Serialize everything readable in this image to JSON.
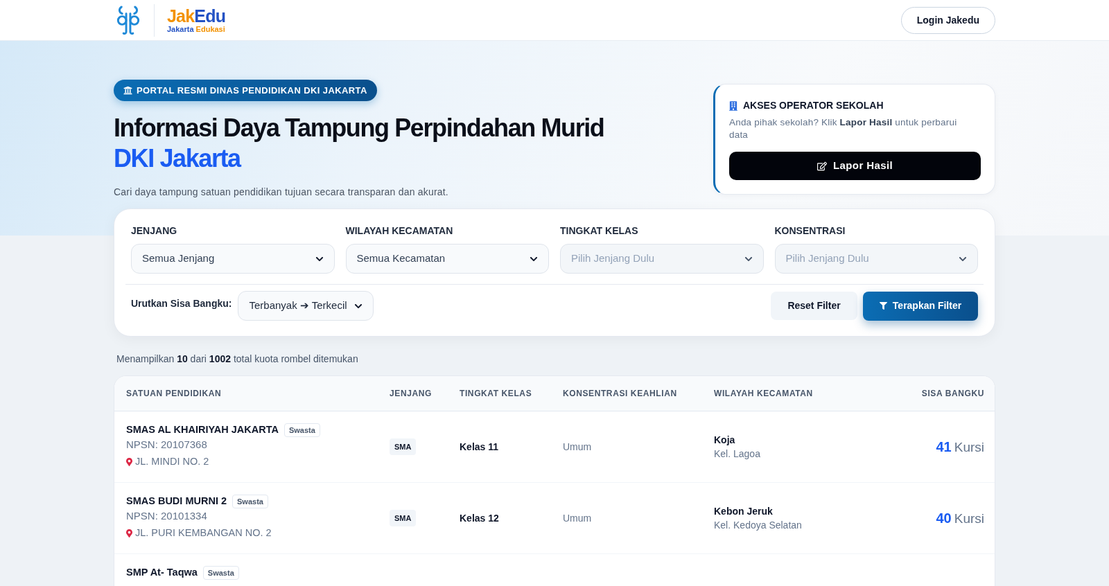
{
  "header": {
    "logo": {
      "wordmark": [
        "Jak",
        "Edu"
      ],
      "tagline": [
        "Jakarta",
        "Edukasi"
      ]
    },
    "login_button": "Login Jakedu"
  },
  "hero": {
    "badge": "PORTAL RESMI DINAS PENDIDIKAN DKI JAKARTA",
    "title": "Informasi Daya Tampung Perpindahan Murid",
    "title_highlight": "DKI Jakarta",
    "subtitle": "Cari daya tampung satuan pendidikan tujuan secara transparan dan akurat."
  },
  "operator_card": {
    "title": "AKSES OPERATOR SEKOLAH",
    "text": "Anda pihak sekolah? Klik **Lapor Hasil** untuk perbarui data",
    "button": "Lapor Hasil"
  },
  "filters": {
    "fields": [
      {
        "label": "JENJANG",
        "value": "Semua Jenjang",
        "disabled": false
      },
      {
        "label": "WILAYAH KECAMATAN",
        "value": "Semua Kecamatan",
        "disabled": false
      },
      {
        "label": "TINGKAT KELAS",
        "value": "Pilih Jenjang Dulu",
        "disabled": true
      },
      {
        "label": "KONSENTRASI",
        "value": "Pilih Jenjang Dulu",
        "disabled": true
      }
    ],
    "sort": {
      "label": "Urutkan Sisa Bangku:",
      "value": "Terbanyak ➔ Terkecil"
    },
    "buttons": [
      {
        "label": "Reset Filter",
        "kind": "secondary"
      },
      {
        "label": "Terapkan Filter",
        "kind": "primary"
      }
    ]
  },
  "results_summary": "Menampilkan **10** dari **1002** total kuota rombel ditemukan",
  "table": {
    "columns": [
      "SATUAN PENDIDIKAN",
      "JENJANG",
      "TINGKAT KELAS",
      "KONSENTRASI KEAHLIAN",
      "WILAYAH KECAMATAN",
      "SISA BANGKU"
    ],
    "rows": [
      {
        "school": "SMAS AL KHAIRIYAH JAKARTA",
        "status": "Swasta",
        "npsn": "NPSN: 20107368",
        "address": "JL. MINDI NO. 2",
        "jenjang": "SMA",
        "grade": "Kelas 11",
        "concentration": "Umum",
        "district": "Koja",
        "village": "Kel. Lagoa",
        "seats": "41",
        "seats_unit": "Kursi"
      },
      {
        "school": "SMAS BUDI MURNI 2",
        "status": "Swasta",
        "npsn": "NPSN: 20101334",
        "address": "JL. PURI KEMBANGAN NO. 2",
        "jenjang": "SMA",
        "grade": "Kelas 12",
        "concentration": "Umum",
        "district": "Kebon Jeruk",
        "village": "Kel. Kedoya Selatan",
        "seats": "40",
        "seats_unit": "Kursi"
      }
    ],
    "cut_off_row": {
      "school": "SMP At- Taqwa",
      "status": "Swasta"
    }
  }
}
